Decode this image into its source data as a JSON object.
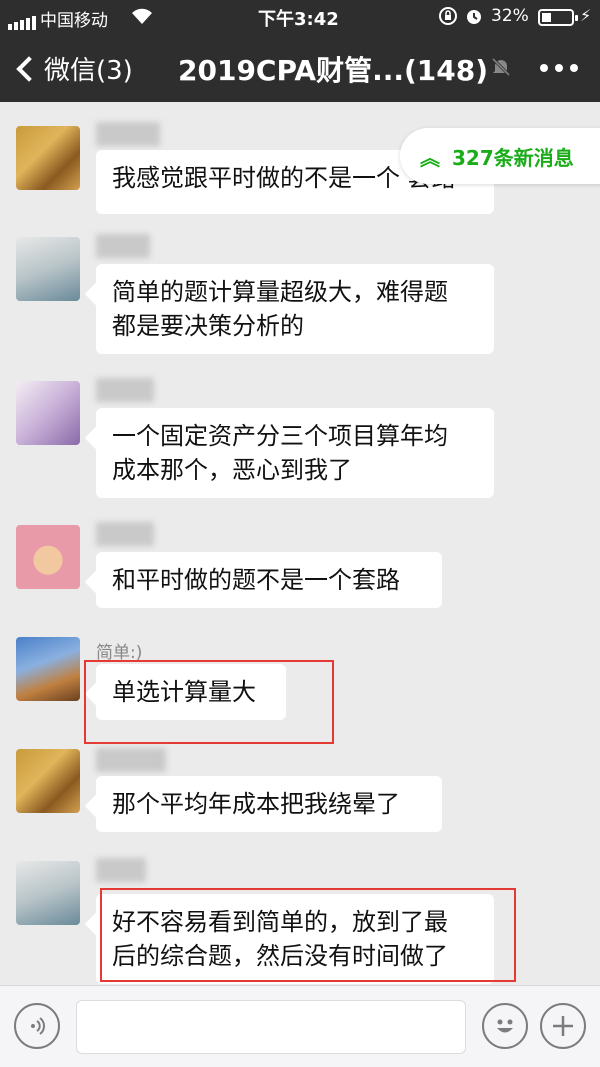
{
  "status_bar": {
    "carrier": "中国移动",
    "time": "下午3:42",
    "battery_percent": "32%",
    "battery_level": 0.32
  },
  "nav": {
    "back_label": "微信(3)",
    "title": "2019CPA财管...(148)"
  },
  "new_messages": "327条新消息",
  "messages": [
    {
      "nickname": "",
      "text": [
        "我感觉跟平时做的不是一个 套路"
      ],
      "avatar": "autumn-path-avatar"
    },
    {
      "nickname": "",
      "text": [
        "简单的题计算量超级大，难得题",
        "都是要决策分析的"
      ],
      "avatar": "boy-avatar"
    },
    {
      "nickname": "",
      "text": [
        "一个固定资产分三个项目算年均",
        "成本那个，恶心到我了"
      ],
      "avatar": "anime-fox-avatar"
    },
    {
      "nickname": "",
      "text": [
        "和平时做的题不是一个套路"
      ],
      "avatar": "chopper-avatar"
    },
    {
      "nickname": "简单:)",
      "text": [
        "单选计算量大"
      ],
      "avatar": "tree-sky-avatar"
    },
    {
      "nickname": "",
      "text": [
        "那个平均年成本把我绕晕了"
      ],
      "avatar": "autumn-path-avatar"
    },
    {
      "nickname": "",
      "text": [
        "好不容易看到简单的，放到了最",
        "后的综合题，然后没有时间做了"
      ],
      "avatar": "boy-avatar"
    }
  ],
  "icons": {
    "signal": "signal-icon",
    "wifi": "wifi-icon",
    "lock": "rotation-lock-icon",
    "alarm": "alarm-icon",
    "battery": "battery-icon",
    "mute": "mute-icon",
    "more": "more-icon",
    "voice": "voice-icon",
    "emoji": "emoji-icon",
    "plus": "plus-icon"
  },
  "colors": {
    "nav_bg": "#2e2e2e",
    "chat_bg": "#ebebeb",
    "accent_green": "#1aad19",
    "highlight_red": "#e53935"
  }
}
